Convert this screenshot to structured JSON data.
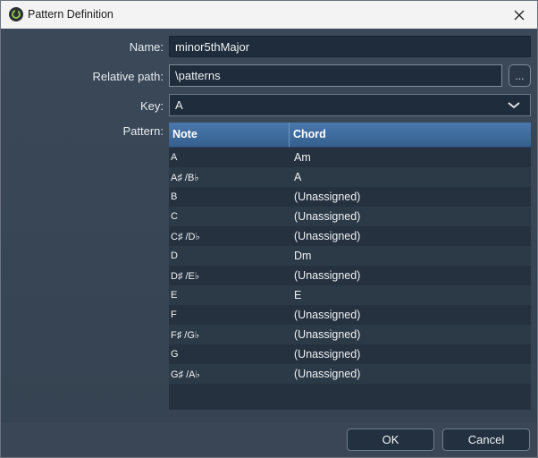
{
  "window": {
    "title": "Pattern Definition"
  },
  "form": {
    "name_label": "Name:",
    "name_value": "minor5thMajor",
    "path_label": "Relative path:",
    "path_value": "\\patterns",
    "browse_label": "...",
    "key_label": "Key:",
    "key_value": "A",
    "pattern_label": "Pattern:"
  },
  "table": {
    "headers": {
      "note": "Note",
      "chord": "Chord"
    },
    "rows": [
      {
        "note": "A",
        "chord": "Am"
      },
      {
        "note": "A♯ /B♭",
        "chord": "A"
      },
      {
        "note": "B",
        "chord": "(Unassigned)"
      },
      {
        "note": "C",
        "chord": "(Unassigned)"
      },
      {
        "note": "C♯ /D♭",
        "chord": "(Unassigned)"
      },
      {
        "note": "D",
        "chord": "Dm"
      },
      {
        "note": "D♯ /E♭",
        "chord": "(Unassigned)"
      },
      {
        "note": "E",
        "chord": "E"
      },
      {
        "note": "F",
        "chord": "(Unassigned)"
      },
      {
        "note": "F♯ /G♭",
        "chord": "(Unassigned)"
      },
      {
        "note": "G",
        "chord": "(Unassigned)"
      },
      {
        "note": "G♯ /A♭",
        "chord": "(Unassigned)"
      }
    ]
  },
  "buttons": {
    "ok": "OK",
    "cancel": "Cancel"
  },
  "icons": {
    "app": "app-logo-icon",
    "close": "close-icon",
    "dropdown": "chevron-down-icon"
  }
}
